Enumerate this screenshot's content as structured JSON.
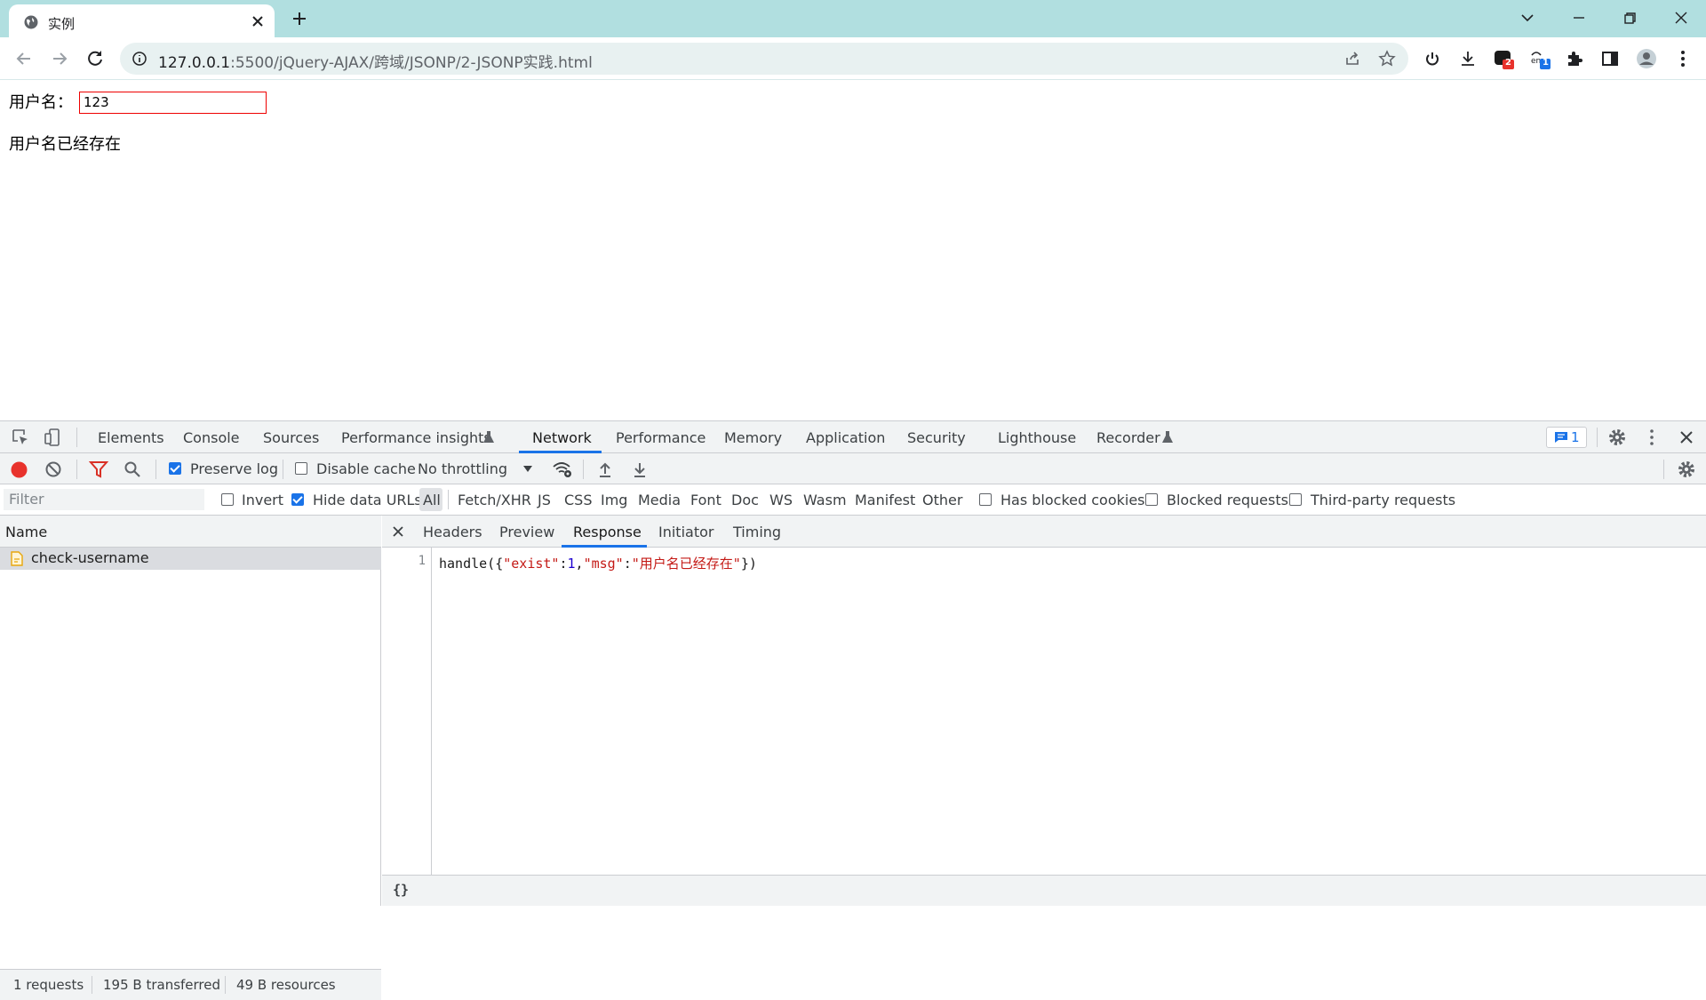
{
  "browser": {
    "tab": {
      "title": "实例"
    },
    "url": {
      "host": "127.0.0.1",
      "path": ":5500/jQuery-AJAX/跨域/JSONP/2-JSONP实践.html"
    },
    "extension_badges": {
      "ext1": "2",
      "ext2": "1"
    }
  },
  "page": {
    "username_label": "用户名：",
    "username_value": "123",
    "message": "用户名已经存在"
  },
  "devtools": {
    "tabs": [
      "Elements",
      "Console",
      "Sources",
      "Performance insights",
      "Network",
      "Performance",
      "Memory",
      "Application",
      "Security",
      "Lighthouse",
      "Recorder"
    ],
    "active_tab": "Network",
    "issues_count": "1",
    "network_toolbar": {
      "preserve_log": "Preserve log",
      "disable_cache": "Disable cache",
      "throttling": "No throttling"
    },
    "filter": {
      "placeholder": "Filter",
      "invert": "Invert",
      "hide_data_urls": "Hide data URLs",
      "types": [
        "All",
        "Fetch/XHR",
        "JS",
        "CSS",
        "Img",
        "Media",
        "Font",
        "Doc",
        "WS",
        "Wasm",
        "Manifest",
        "Other"
      ],
      "has_blocked_cookies": "Has blocked cookies",
      "blocked_requests": "Blocked requests",
      "third_party": "Third-party requests"
    },
    "request_list": {
      "header": "Name",
      "rows": [
        "check-username"
      ]
    },
    "status": {
      "requests": "1 requests",
      "transferred": "195 B transferred",
      "resources": "49 B resources"
    },
    "detail_tabs": [
      "Headers",
      "Preview",
      "Response",
      "Initiator",
      "Timing"
    ],
    "active_detail_tab": "Response",
    "response": {
      "line_number": "1",
      "code_prefix": "handle({",
      "key1": "\"exist\"",
      "colon1": ":",
      "val1": "1",
      "comma": ",",
      "key2": "\"msg\"",
      "colon2": ":",
      "val2": "\"用户名已经存在\"",
      "code_suffix": "})"
    },
    "pretty_print": "{}"
  },
  "colors": {
    "tabstrip": "#b1dfe0",
    "accent": "#1a73e8",
    "record": "#e8322c",
    "input_border": "#ee0000"
  }
}
